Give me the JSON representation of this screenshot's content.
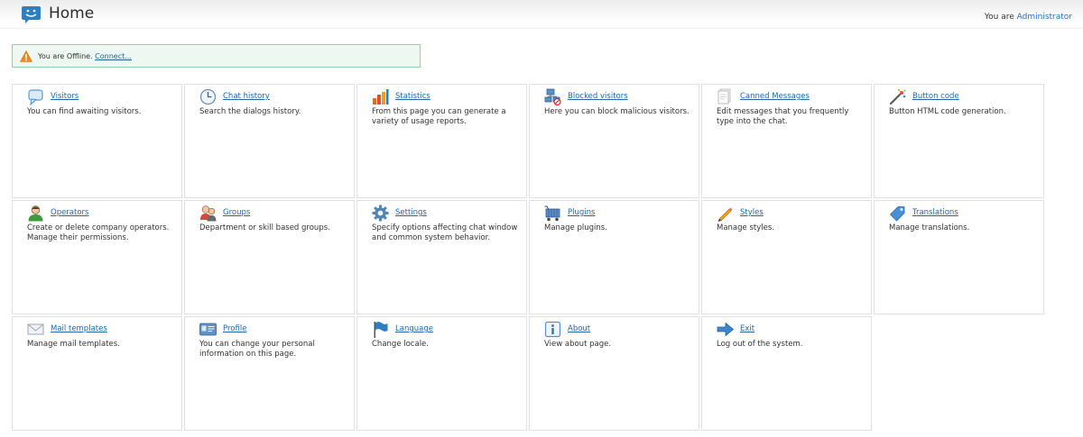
{
  "header": {
    "title": "Home",
    "user_prefix": "You are",
    "user_name": "Administrator"
  },
  "status": {
    "text": "You are Offline.",
    "link": "Connect..."
  },
  "tiles": [
    {
      "label": "Visitors",
      "desc": "You can find awaiting visitors.",
      "icon": "speech-bubble-icon"
    },
    {
      "label": "Chat history",
      "desc": "Search the dialogs history.",
      "icon": "clock-icon"
    },
    {
      "label": "Statistics",
      "desc": "From this page you can generate a variety of usage reports.",
      "icon": "bar-chart-icon"
    },
    {
      "label": "Blocked visitors",
      "desc": "Here you can block malicious visitors.",
      "icon": "blocked-network-icon"
    },
    {
      "label": "Canned Messages",
      "desc": "Edit messages that you frequently type into the chat.",
      "icon": "documents-icon"
    },
    {
      "label": "Button code",
      "desc": "Button HTML code generation.",
      "icon": "magic-wand-icon"
    },
    {
      "label": "Operators",
      "desc": "Create or delete company operators. Manage their permissions.",
      "icon": "user-icon"
    },
    {
      "label": "Groups",
      "desc": "Department or skill based groups.",
      "icon": "group-icon"
    },
    {
      "label": "Settings",
      "desc": "Specify options affecting chat window and common system behavior.",
      "icon": "gear-icon"
    },
    {
      "label": "Plugins",
      "desc": "Manage plugins.",
      "icon": "plugin-cart-icon"
    },
    {
      "label": "Styles",
      "desc": "Manage styles.",
      "icon": "pencil-icon"
    },
    {
      "label": "Translations",
      "desc": "Manage translations.",
      "icon": "tag-icon"
    },
    {
      "label": "Mail templates",
      "desc": "Manage mail templates.",
      "icon": "envelope-icon"
    },
    {
      "label": "Profile",
      "desc": "You can change your personal information on this page.",
      "icon": "id-card-icon"
    },
    {
      "label": "Language",
      "desc": "Change locale.",
      "icon": "flag-icon"
    },
    {
      "label": "About",
      "desc": "View about page.",
      "icon": "info-icon"
    },
    {
      "label": "Exit",
      "desc": "Log out of the system.",
      "icon": "arrow-right-icon"
    }
  ]
}
